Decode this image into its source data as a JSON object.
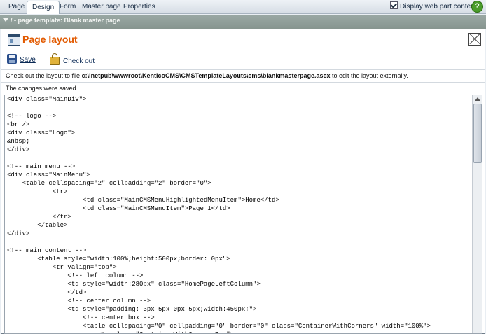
{
  "tabs": [
    {
      "label": "Page",
      "active": false
    },
    {
      "label": "Design",
      "active": true
    },
    {
      "label": "Form",
      "active": false
    },
    {
      "label": "Master page",
      "active": false
    },
    {
      "label": "Properties",
      "active": false
    }
  ],
  "display_web_part_content": {
    "label": "Display web part content",
    "checked": true
  },
  "help_icon": "?",
  "template_bar": {
    "text": "/ - page template: Blank master page"
  },
  "dialog": {
    "title": "Page layout",
    "toolbar": {
      "save_label": "Save",
      "checkout_label": "Check out"
    },
    "info": {
      "prefix": "Check out the layout to file ",
      "path": "c:\\Inetpub\\wwwroot\\KenticoCMS\\CMSTemplateLayouts\\cms\\blankmasterpage.ascx",
      "suffix": " to edit the layout externally."
    },
    "status": "The changes were saved.",
    "code": "<div class=\"MainDiv\">\n\n<!-- logo -->\n<br />\n<div class=\"Logo\">\n&nbsp;\n</div>\n\n<!-- main menu -->\n<div class=\"MainMenu\">\n    <table cellspacing=\"2\" cellpadding=\"2\" border=\"0\">\n            <tr>\n                    <td class=\"MainCMSMenuHighlightedMenuItem\">Home</td>\n                    <td class=\"MainCMSMenuItem\">Page 1</td>\n            </tr>\n        </table>\n</div>\n\n<!-- main content -->\n        <table style=\"width:100%;height:500px;border: 0px\">\n            <tr valign=\"top\">\n                <!-- left column -->\n                <td style=\"width:280px\" class=\"HomePageLeftColumn\">\n                </td>\n                <!-- center column -->\n                <td style=\"padding: 3px 5px 0px 5px;width:450px;\">\n                    <!-- center box -->\n                    <table cellspacing=\"0\" cellpadding=\"0\" border=\"0\" class=\"ContainerWithCorners\" width=\"100%\">\n                        <tr class=\"ContainerWithCornersRow\">\n                            <td class=\"ContainerWithCornersTopLeft\">&nbsp;</td>"
  },
  "icons": {
    "save": "floppy-disk-icon",
    "checkout": "padlock-icon",
    "dialog": "page-layout-icon",
    "close": "close-icon",
    "help": "help-icon",
    "expand": "chevron-down-icon"
  }
}
